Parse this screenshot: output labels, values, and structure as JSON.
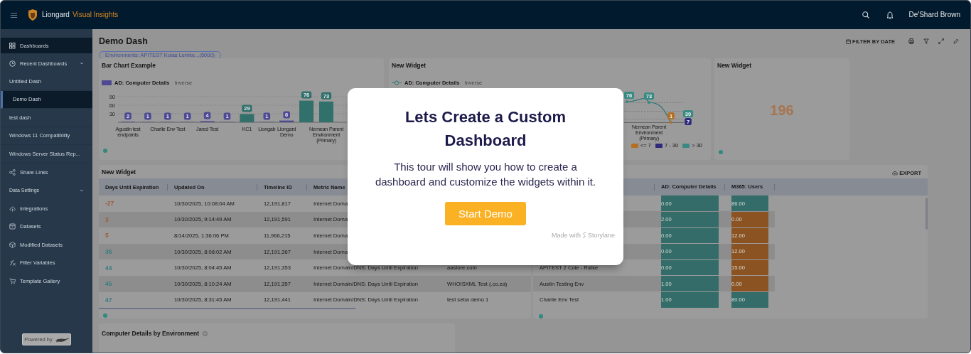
{
  "topbar": {
    "brand": "Liongard",
    "product": "Visual Insights",
    "user": "De'Shard Brown"
  },
  "sidebar": {
    "items": [
      {
        "kind": "nav",
        "label": "Dashboards",
        "selected": true
      },
      {
        "kind": "group",
        "label": "Recent Dashboards",
        "expanded": true
      },
      {
        "kind": "sub",
        "label": "Untitled Dash",
        "selected": false
      },
      {
        "kind": "sub",
        "label": "Demo Dash",
        "selected": true
      },
      {
        "kind": "sub",
        "label": "test dash",
        "selected": false
      },
      {
        "kind": "sub",
        "label": "Windows 11 Compatibility",
        "selected": false
      },
      {
        "kind": "sub",
        "label": "Windows Server Status Rep...",
        "selected": false
      },
      {
        "kind": "nav",
        "label": "Share Links",
        "selected": false
      },
      {
        "kind": "section",
        "label": "Data Settings",
        "expanded": true
      },
      {
        "kind": "nav",
        "label": "Integrations",
        "selected": false
      },
      {
        "kind": "nav",
        "label": "Datasets",
        "selected": false
      },
      {
        "kind": "nav",
        "label": "Modified Datasets",
        "selected": false
      },
      {
        "kind": "nav",
        "label": "Filter Variables",
        "selected": false
      },
      {
        "kind": "nav",
        "label": "Template Gallery",
        "selected": false
      }
    ],
    "footer": "Powered by"
  },
  "dashboard": {
    "title": "Demo Dash",
    "filter_chip": "Environments: APITEST Kulas Lemke...(5000)",
    "filter_label": "FILTER BY DATE"
  },
  "bar_widget": {
    "title": "Bar Chart Example",
    "inverse_label": "Inverse",
    "chart_data": {
      "type": "bar",
      "categories": [
        "Agustin test endpoints",
        null,
        "Charlie Env Test",
        null,
        "Jared Test",
        null,
        "KC1",
        "Liongab",
        "Liongard Demo",
        null,
        "Nemean Parent Environment (Primary)"
      ],
      "series": [
        {
          "name": "AD: Computer Details",
          "color": "#4d4a93",
          "values": [
            2,
            1,
            1,
            1,
            4,
            1,
            null,
            1,
            6,
            null,
            null
          ]
        },
        {
          "color": "#31706b",
          "values": [
            null,
            null,
            null,
            null,
            null,
            null,
            29,
            null,
            null,
            76,
            73
          ]
        }
      ],
      "stacked": true,
      "ylim": [
        0,
        90
      ],
      "yticks": [
        30,
        60,
        90
      ],
      "data_labels": true
    }
  },
  "line_widget": {
    "title": "New Widget",
    "inverse_label": "Inverse",
    "chart_data": {
      "type": "line",
      "series": [
        {
          "name": "AD: Computer Details",
          "color": "#2f7874",
          "values": [
            76,
            73,
            1
          ]
        }
      ],
      "data_labels": true
    },
    "points": [
      {
        "color": "#3a8a84"
      },
      {
        "color": "#3a8a84"
      },
      {
        "color": "#b56f22"
      }
    ],
    "category_label": "Nemean Parent Environment (Primary)",
    "end_badges": [
      {
        "text": "30",
        "color": "#3a8a84"
      },
      {
        "text": "7",
        "color": "#2d2a7c"
      }
    ],
    "thresholds": [
      {
        "label": "<= 7",
        "color": "#b56f22"
      },
      {
        "label": "7 - 30",
        "color": "#2d2a7c"
      },
      {
        "label": "> 30",
        "color": "#3a8a84"
      }
    ]
  },
  "number_widget": {
    "title": "New Widget",
    "value": "196"
  },
  "table_widget": {
    "title": "New Widget",
    "columns": [
      "Days Until Expiration",
      "Updated On",
      "Timeline ID",
      "Metric Name"
    ],
    "rows": [
      {
        "color": "#a05a3a",
        "cells": [
          "-27",
          "10/30/2025, 10:08:04 AM",
          "12,191,817",
          "Internet Doma"
        ]
      },
      {
        "color": "#a05a3a",
        "cells": [
          "3",
          "10/30/2025, 9:14:49 AM",
          "12,191,591",
          "Internet Doma"
        ]
      },
      {
        "color": "#a05a3a",
        "cells": [
          "5",
          "8/14/2025, 1:36:06 PM",
          "11,966,215",
          "Internet Doma"
        ]
      },
      {
        "color": "#3b7c84",
        "cells": [
          "36",
          "10/30/2025, 8:08:02 AM",
          "12,191,367",
          "Internet Doma"
        ]
      },
      {
        "color": "#3b7c84",
        "cells": [
          "44",
          "10/30/2025, 8:04:45 AM",
          "12,191,353",
          "Internet Domain/DNS: Days Until Expiration",
          "aastore.com"
        ]
      },
      {
        "color": "#3b7c84",
        "cells": [
          "45",
          "10/30/2025, 8:10:24 AM",
          "12,191,357",
          "Internet Domain/DNS: Days Until Expiration",
          "WHOISXML Test (.co.za)"
        ]
      },
      {
        "color": "#3b7c84",
        "cells": [
          "47",
          "10/30/2025, 8:31:45 AM",
          "12,191,441",
          "Internet Domain/DNS: Days Until Expiration",
          "test seba demo 1"
        ]
      }
    ]
  },
  "pivot_widget": {
    "export_label": "EXPORT",
    "columns": [
      "AD: Computer Details",
      "M365: Users"
    ],
    "rows": [
      {
        "values": [
          {
            "text": "0.00",
            "color": "#336c68"
          },
          {
            "text": "86.00",
            "color": "#336c68"
          }
        ]
      },
      {
        "values": [
          {
            "text": "2.00",
            "color": "#336c68"
          },
          {
            "text": "0.00",
            "color": "#8b5322"
          }
        ]
      },
      {
        "values": [
          {
            "text": "0.00",
            "color": "#336c68"
          },
          {
            "text": "12.00",
            "color": "#8b5322"
          }
        ]
      },
      {
        "values": [
          {
            "text": "0.00",
            "color": "#336c68"
          },
          {
            "text": "12.00",
            "color": "#8b5322"
          }
        ]
      },
      {
        "column_1": "APITEST 2 Cole - Ratke",
        "values": [
          {
            "text": "0.00",
            "color": "#336c68"
          },
          {
            "text": "15.00",
            "color": "#8b5322"
          }
        ]
      },
      {
        "column_1": "Austin Testing Env",
        "values": [
          {
            "text": "1.00",
            "color": "#336c68"
          },
          {
            "text": "0.00",
            "color": "#8b5322"
          }
        ]
      },
      {
        "column_1": "Charlie Env Test",
        "values": [
          {
            "text": "1.00",
            "color": "#336c68"
          },
          {
            "text": "80.00",
            "color": "#336c68"
          }
        ]
      }
    ]
  },
  "bottom_widget": {
    "title": "Computer Details by Environment"
  },
  "modal": {
    "title": "Lets Create a Custom Dashboard",
    "body": "This tour will show you how to create a dashboard and customize the widgets within it.",
    "button": "Start Demo",
    "footer_prefix": "Made with",
    "footer_brand": "Storylane"
  }
}
